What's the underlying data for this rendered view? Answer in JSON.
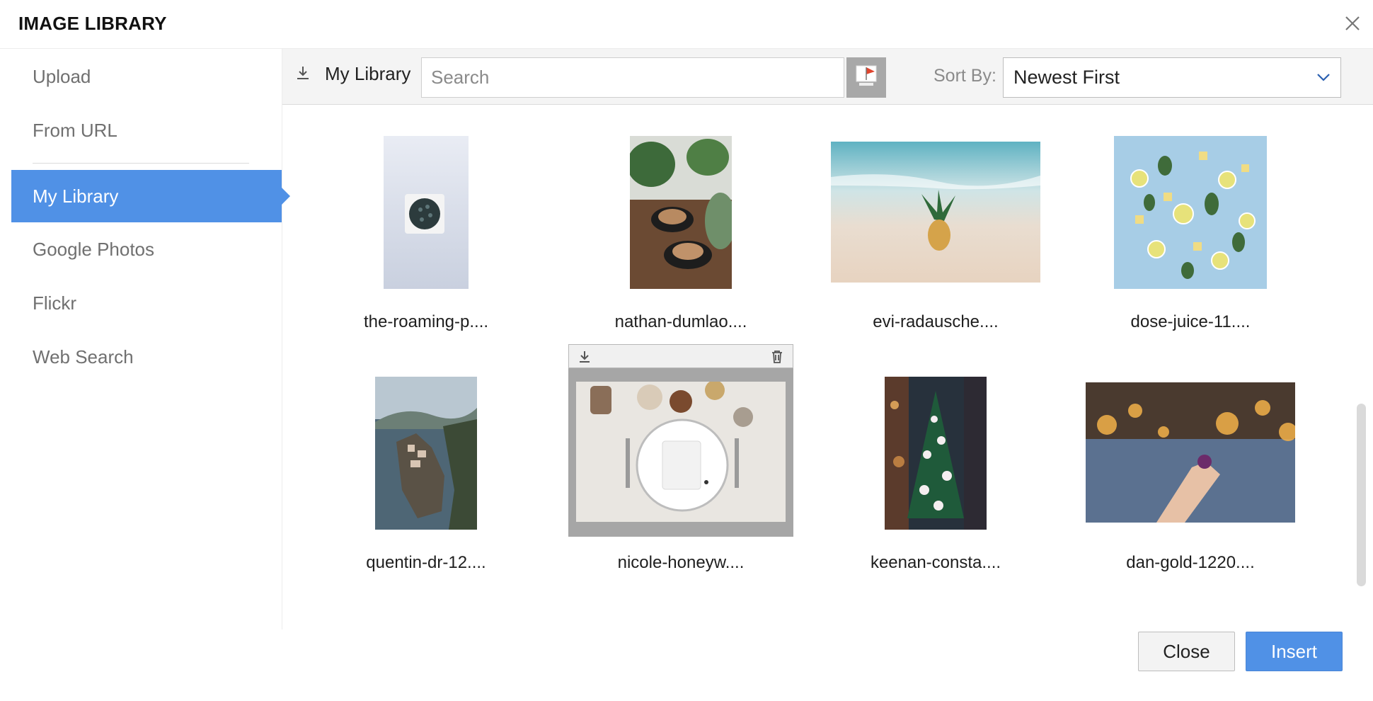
{
  "dialog": {
    "title": "IMAGE LIBRARY"
  },
  "sidebar": {
    "items": [
      {
        "label": "Upload"
      },
      {
        "label": "From URL"
      },
      {
        "label": "My Library"
      },
      {
        "label": "Google Photos"
      },
      {
        "label": "Flickr"
      },
      {
        "label": "Web Search"
      }
    ],
    "active": "My Library"
  },
  "toolbar": {
    "label": "My Library",
    "search_placeholder": "Search",
    "sort_label": "Sort By:",
    "sort_value": "Newest First"
  },
  "images": [
    {
      "caption": "the-roaming-p...."
    },
    {
      "caption": "nathan-dumlao...."
    },
    {
      "caption": "evi-radausche...."
    },
    {
      "caption": "dose-juice-11...."
    },
    {
      "caption": "quentin-dr-12...."
    },
    {
      "caption": "nicole-honeyw...."
    },
    {
      "caption": "keenan-consta...."
    },
    {
      "caption": "dan-gold-1220...."
    }
  ],
  "footer": {
    "close_label": "Close",
    "insert_label": "Insert"
  },
  "colors": {
    "accent": "#5091e6",
    "text": "#222222",
    "muted": "#707070"
  }
}
